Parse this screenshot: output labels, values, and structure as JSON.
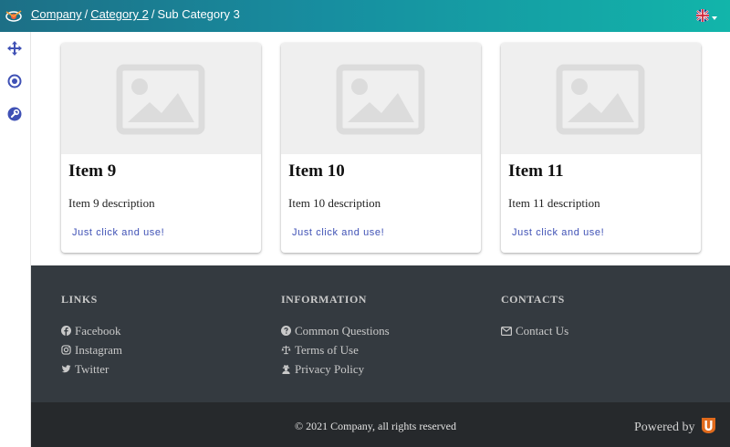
{
  "breadcrumb": {
    "items": [
      "Company",
      "Category 2"
    ],
    "separator": "/",
    "current": "Sub Category 3"
  },
  "language": {
    "flag_icon": "uk-flag-icon",
    "selected": "en"
  },
  "rail": {
    "icons": [
      "move-arrows-icon",
      "target-icon",
      "wrench-icon"
    ],
    "accent": "#3f51b5"
  },
  "cards": [
    {
      "title": "Item 9",
      "description": "Item 9 description",
      "action": "Just click and use!"
    },
    {
      "title": "Item 10",
      "description": "Item 10 description",
      "action": "Just click and use!"
    },
    {
      "title": "Item 11",
      "description": "Item 11 description",
      "action": "Just click and use!"
    }
  ],
  "footer": {
    "links": {
      "heading": "LINKS",
      "items": [
        "Facebook",
        "Instagram",
        "Twitter"
      ]
    },
    "information": {
      "heading": "INFORMATION",
      "items": [
        "Common Questions",
        "Terms of Use",
        "Privacy Policy"
      ]
    },
    "contacts": {
      "heading": "CONTACTS",
      "items": [
        "Contact Us"
      ]
    },
    "copyright": "© 2021 Company, all rights reserved",
    "powered_by": "Powered by"
  },
  "colors": {
    "header_start": "#1d6f86",
    "header_end": "#12b5aa",
    "footer": "#343a40",
    "bottom_bar": "#26292c",
    "action": "#3f51b5"
  }
}
